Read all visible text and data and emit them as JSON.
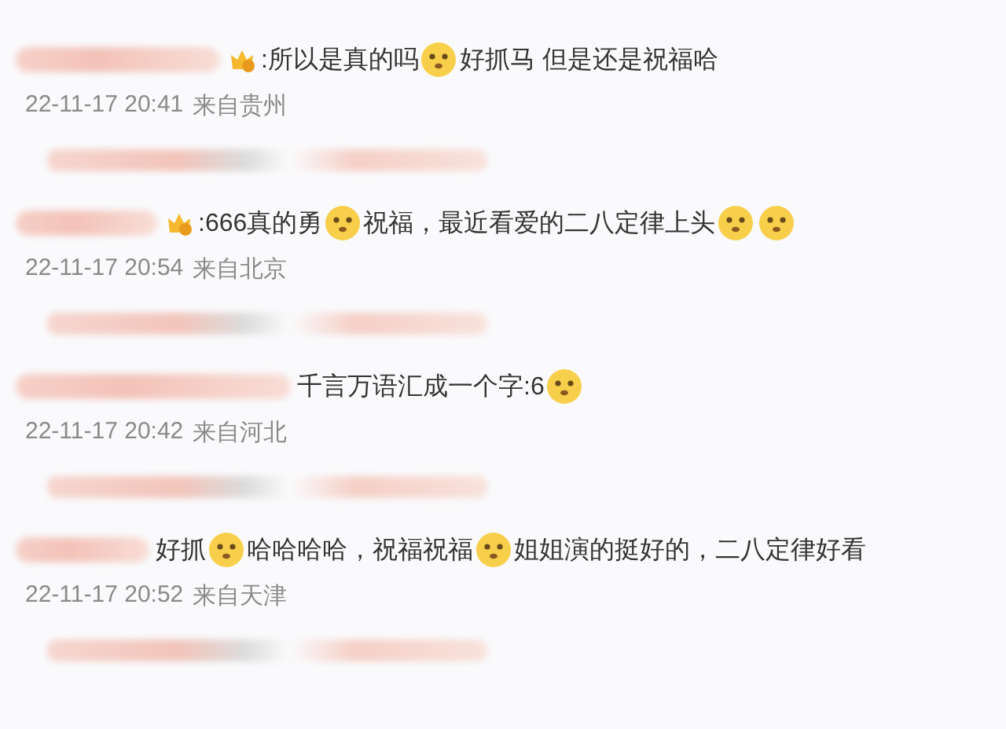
{
  "comments": [
    {
      "badge": true,
      "segments": [
        {
          "kind": "text",
          "text": ":所以是真的吗"
        },
        {
          "kind": "emoji"
        },
        {
          "kind": "text",
          "text": "好抓马 但是还是祝福哈"
        }
      ],
      "time": "22-11-17 20:41",
      "location": "来自贵州"
    },
    {
      "badge": true,
      "segments": [
        {
          "kind": "text",
          "text": ":666真的勇"
        },
        {
          "kind": "emoji"
        },
        {
          "kind": "text",
          "text": "祝福，最近看爱的二八定律上头"
        },
        {
          "kind": "emoji"
        },
        {
          "kind": "emoji"
        }
      ],
      "time": "22-11-17 20:54",
      "location": "来自北京"
    },
    {
      "badge": false,
      "segments": [
        {
          "kind": "text",
          "text": "千言万语汇成一个字:6"
        },
        {
          "kind": "emoji"
        }
      ],
      "time": "22-11-17 20:42",
      "location": "来自河北"
    },
    {
      "badge": false,
      "segments": [
        {
          "kind": "text",
          "text": "好抓"
        },
        {
          "kind": "emoji"
        },
        {
          "kind": "text",
          "text": "哈哈哈哈，祝福祝福"
        },
        {
          "kind": "emoji"
        },
        {
          "kind": "text",
          "text": "姐姐演的挺好的，二八定律好看"
        }
      ],
      "time": "22-11-17 20:52",
      "location": "来自天津"
    }
  ]
}
